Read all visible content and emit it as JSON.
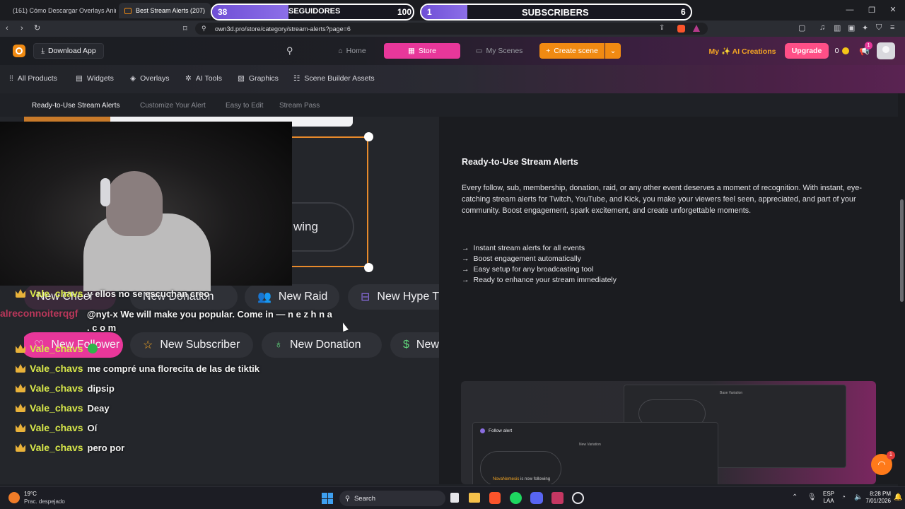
{
  "browser": {
    "tabs": [
      {
        "title": "(161) Cómo Descargar Overlays Anim"
      },
      {
        "title": "Best Stream Alerts (207)"
      }
    ],
    "url": "own3d.pro/store/category/stream-alerts?page=6"
  },
  "stream_overlay": {
    "followers": {
      "current": "38",
      "label": "SEGUIDORES",
      "goal": "100",
      "progress": 0.38
    },
    "subscribers": {
      "current": "1",
      "label": "SUBSCRIBERS",
      "goal": "6",
      "progress": 0.17
    }
  },
  "site": {
    "download_app": "Download App",
    "nav": {
      "home": "Home",
      "store": "Store",
      "my_scenes": "My Scenes",
      "create_scene": "Create scene"
    },
    "ai_creations": "My ✨ AI Creations",
    "upgrade": "Upgrade",
    "coins": "0",
    "notif_count": "1",
    "categories": [
      "All Products",
      "Widgets",
      "Overlays",
      "AI Tools",
      "Graphics",
      "Scene Builder Assets"
    ],
    "sub_tabs": [
      "Ready-to-Use Stream Alerts",
      "Customize Your Alert",
      "Easy to Edit",
      "Stream Pass"
    ]
  },
  "preview": {
    "following_text": "wing",
    "row1": [
      "New Cheer",
      "New Donation",
      "New Raid",
      "New Hype T"
    ],
    "row2": [
      "New Follower",
      "New Subscriber",
      "New Donation",
      "New"
    ]
  },
  "info": {
    "heading": "Ready-to-Use Stream Alerts",
    "body": "Every follow, sub, membership, donation, raid, or any other event deserves a moment of recognition. With instant, eye-catching stream alerts for Twitch, YouTube, and Kick, you make your viewers feel seen, appreciated, and part of your community. Boost engagement, spark excitement, and create unforgettable moments.",
    "bullets": [
      "Instant stream alerts for all events",
      "Boost engagement automatically",
      "Easy setup for any broadcasting tool",
      "Ready to enhance your stream immediately"
    ]
  },
  "editor_preview": {
    "follow_alert": "Follow alert",
    "new_variation": "New Variation",
    "base_variation": "Base Variation",
    "now_following_name": "NovaNemesis",
    "now_following_text": "is now following"
  },
  "chat": {
    "messages": [
      {
        "user": "Vale_chavs",
        "text": "y ellos no se escuchan creo"
      },
      {
        "user": "alreconnoiterqgf",
        "text": "@nyt-x We will make you popular. Come in — n e z h n a . c o m"
      },
      {
        "user": "Vale_chavs",
        "text": ""
      },
      {
        "user": "Vale_chavs",
        "text": "me compré una florecita de las de tiktik"
      },
      {
        "user": "Vale_chavs",
        "text": "dipsip"
      },
      {
        "user": "Vale_chavs",
        "text": "Deay"
      },
      {
        "user": "Vale_chavs",
        "text": "Oí"
      },
      {
        "user": "Vale_chavs",
        "text": "pero por"
      }
    ]
  },
  "taskbar": {
    "weather_temp": "19°C",
    "weather_desc": "Prac. despejado",
    "search": "Search",
    "lang": "ESP",
    "lang2": "LAA",
    "time": "8:28 PM",
    "date": "7/01/2026",
    "help_badge": "1"
  },
  "colors": {
    "store_active": "#e8379a",
    "create_scene": "#f08a12",
    "upgrade": "#ff4f87",
    "follower_fill": "#7b5be0",
    "username": "#d8e84a"
  }
}
